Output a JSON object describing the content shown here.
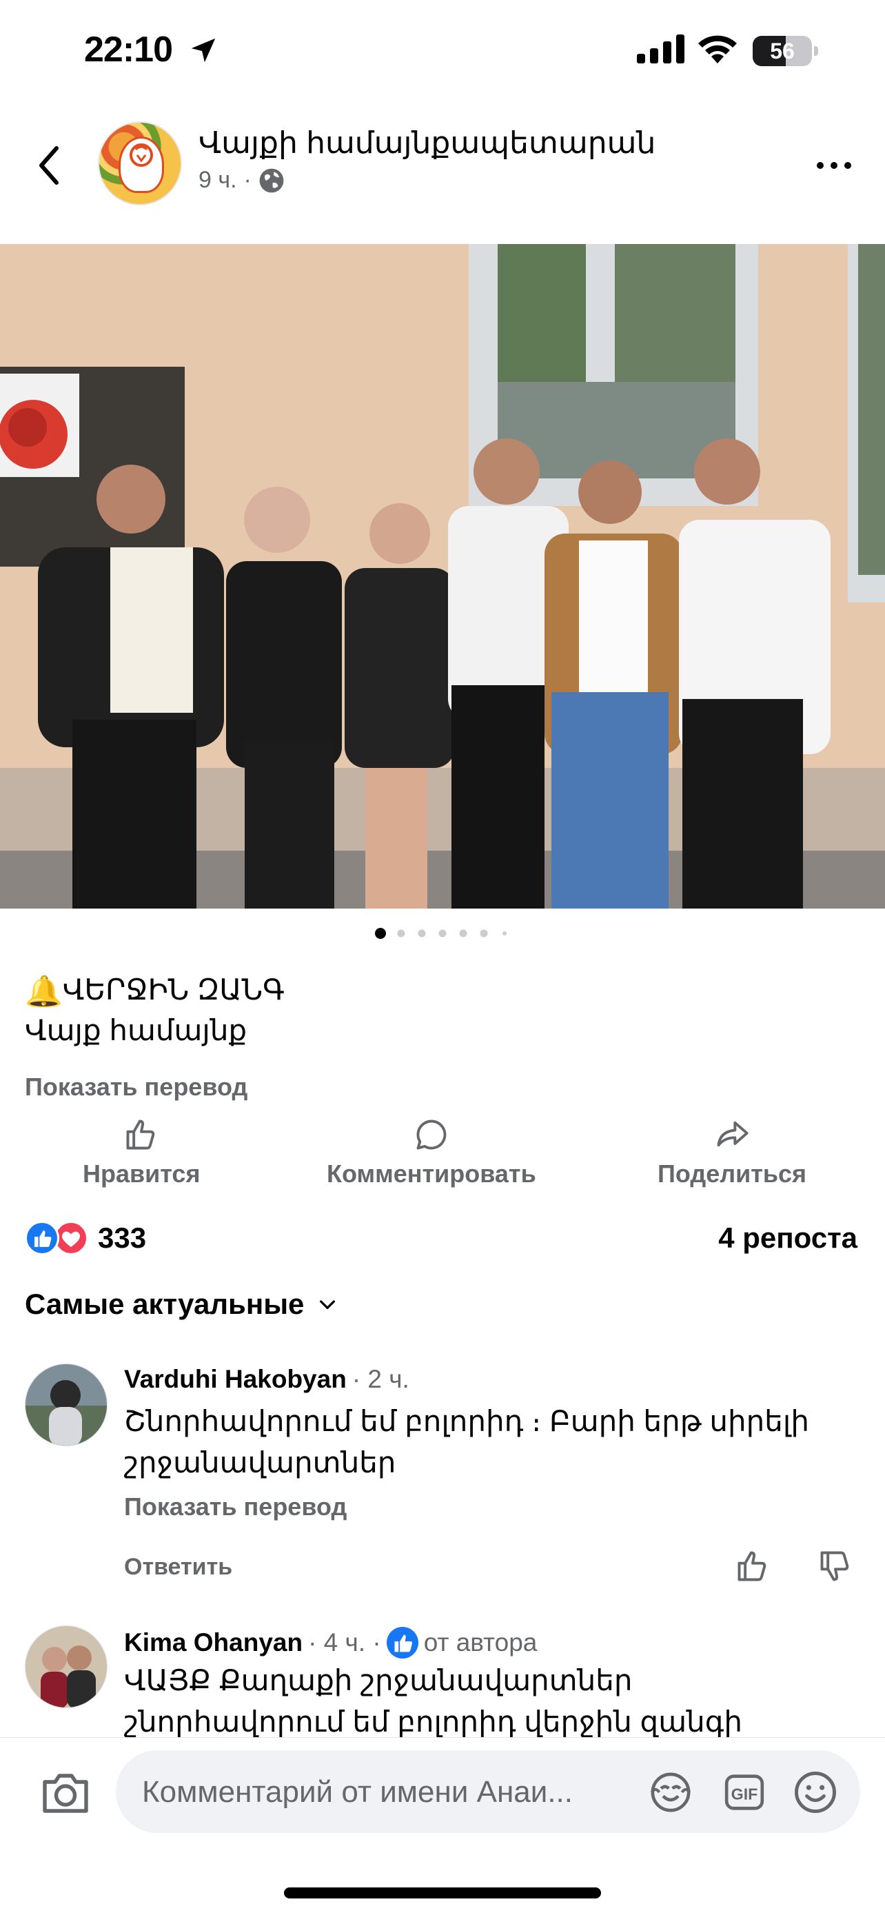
{
  "status_bar": {
    "time": "22:10",
    "battery": "56",
    "battery_level": 0.56
  },
  "post": {
    "page_name": "Վայքի համայնքապետարան",
    "time": "9 ч.",
    "separator": "·",
    "caption_line1": "ՎԵՐՋԻՆ ԶԱՆԳ",
    "caption_emoji": "🔔",
    "caption_line2": "Վայք համայնք",
    "translate": "Показать перевод",
    "carousel_count": 7,
    "carousel_active": 1
  },
  "actions": {
    "like": "Нравится",
    "comment": "Комментировать",
    "share": "Поделиться"
  },
  "stats": {
    "reactions_count": "333",
    "reposts": "4 репоста"
  },
  "sort": {
    "label": "Самые актуальные"
  },
  "comments": [
    {
      "author": "Varduhi Hakobyan",
      "time": "· 2 ч.",
      "text": "Շնորհավորում եմ բոլորիդ ։ Բարի երթ սիրելի շրջանավարտներ",
      "translate": "Показать перевод",
      "reply": "Ответить"
    },
    {
      "author": "Kima Ohanyan",
      "time": "· 4 ч. ·",
      "badge_label": "от автора",
      "text": "ՎԱՅՔ Քաղաքի շրջանավարտներ շնորհավորում եմ բոլորիդ վերջին զանգի կապակցությամբ❤️ ❤️"
    }
  ],
  "composer": {
    "placeholder": "Комментарий от имени Анаи..."
  },
  "colors": {
    "facebook_blue": "#1877f2",
    "love_red": "#f33e58",
    "secondary_text": "#65676b",
    "input_bg": "#f0f2f5"
  }
}
